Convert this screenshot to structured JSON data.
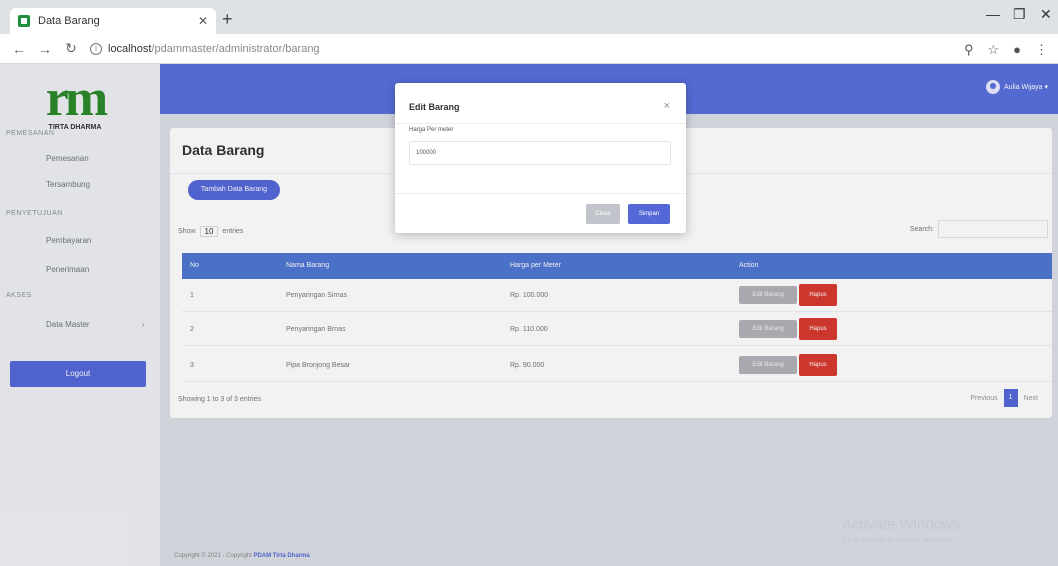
{
  "browser": {
    "tab_title": "Data Barang",
    "url_host": "localhost",
    "url_path": "/pdammaster/administrator/barang"
  },
  "sidebar": {
    "logo_text": "rm",
    "logo_sub": "TIRTA DHARMA",
    "sections": [
      {
        "heading": "PEMESANAN",
        "items": [
          "Pemesanan",
          "Tersambung"
        ]
      },
      {
        "heading": "PENYETUJUAN",
        "items": [
          "Pembayaran",
          "Penerimaan"
        ]
      },
      {
        "heading": "AKSES",
        "items": [
          "Data Master"
        ]
      }
    ],
    "logout_label": "Logout"
  },
  "header": {
    "user_name": "Aulia Wijaya"
  },
  "page": {
    "title": "Data Barang",
    "add_button": "Tambah Data Barang",
    "show_label": "Show",
    "show_value": "10",
    "entries_label": "entries",
    "search_label": "Search:",
    "columns": [
      "No",
      "Nama Barang",
      "Harga per Meter",
      "Action"
    ],
    "rows": [
      {
        "no": "1",
        "name": "Penyaringan Sirnas",
        "price": "Rp. 100.000"
      },
      {
        "no": "2",
        "name": "Penyaringan Brnas",
        "price": "Rp. 110.000"
      },
      {
        "no": "3",
        "name": "Pipa Bronjong Besar",
        "price": "Rp. 90.000"
      }
    ],
    "edit_label": "Edit Barang",
    "delete_label": "Hapus",
    "showing_text": "Showing 1 to 3 of 3 entries",
    "pager": {
      "prev": "Previous",
      "page": "1",
      "next": "Next"
    }
  },
  "footer": {
    "text": "Copyright © 2021 - Copyright",
    "brand": "PDAM Tirta Dharma"
  },
  "watermark": {
    "title": "Activate Windows",
    "subtitle": "Go to Settings to activate Windows."
  },
  "modal": {
    "title": "Edit Barang",
    "field_label": "Harga Per meter",
    "field_value": "100000",
    "close_label": "Close",
    "save_label": "Simpan"
  },
  "colors": {
    "primary": "#5468d8",
    "table_header": "#4f76d3",
    "danger": "#d63a30",
    "logo_green": "#2d8a2b"
  }
}
